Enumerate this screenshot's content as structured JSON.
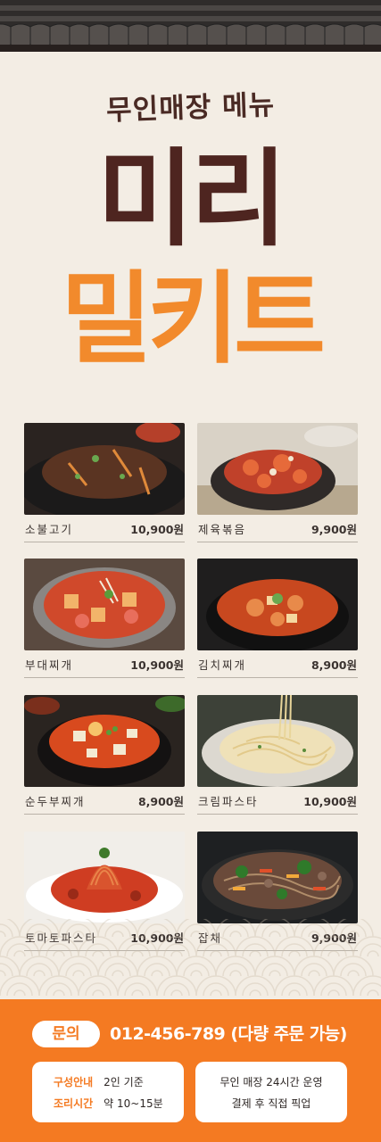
{
  "header": {
    "eyebrow": "무인매장 메뉴",
    "title_line1": "미리",
    "title_line2": "밀키트"
  },
  "menu": [
    {
      "name": "소불고기",
      "price": "10,900원",
      "photo": "bulgogi"
    },
    {
      "name": "제육볶음",
      "price": "9,900원",
      "photo": "jeyuk"
    },
    {
      "name": "부대찌개",
      "price": "10,900원",
      "photo": "budae"
    },
    {
      "name": "김치찌개",
      "price": "8,900원",
      "photo": "kimchi"
    },
    {
      "name": "순두부찌개",
      "price": "8,900원",
      "photo": "sundubu"
    },
    {
      "name": "크림파스타",
      "price": "10,900원",
      "photo": "cream-pasta"
    },
    {
      "name": "토마토파스타",
      "price": "10,900원",
      "photo": "tomato-pasta"
    },
    {
      "name": "잡채",
      "price": "9,900원",
      "photo": "japchae"
    }
  ],
  "footer": {
    "inquiry_label": "문의",
    "phone": "012-456-789 (다량 주문 가능)",
    "info": [
      {
        "key": "구성안내",
        "value": "2인 기준"
      },
      {
        "key": "조리시간",
        "value": "약 10~15분"
      }
    ],
    "notes": [
      "무인 매장 24시간 운영",
      "결제 후 직접 픽업"
    ]
  },
  "colors": {
    "brand_orange": "#f47a22",
    "title_brown": "#4e2520",
    "title_orange": "#f28a2c",
    "background": "#f3ede4"
  }
}
